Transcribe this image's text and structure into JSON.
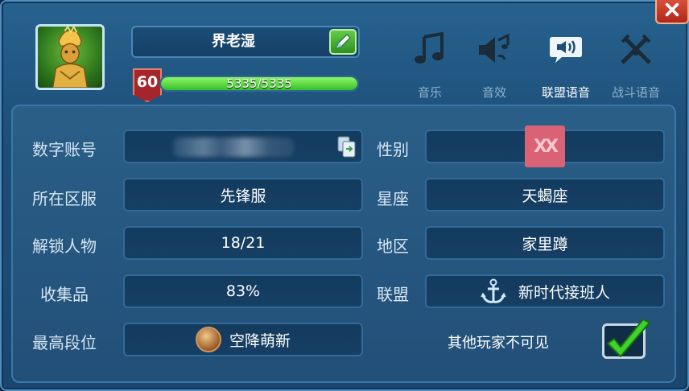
{
  "profile": {
    "name": "界老湿",
    "level": "60",
    "exp_text": "5335/5335",
    "exp_fraction": 1.0
  },
  "sound_tabs": [
    {
      "label": "音乐",
      "icon": "music-note-icon",
      "active": false
    },
    {
      "label": "音效",
      "icon": "sound-effect-icon",
      "active": false
    },
    {
      "label": "联盟语音",
      "icon": "speech-bubble-icon",
      "active": true
    },
    {
      "label": "战斗语音",
      "icon": "crossed-swords-icon",
      "active": false
    }
  ],
  "info": {
    "account_label": "数字账号",
    "gender_label": "性别",
    "gender_icon": "XX",
    "server_label": "所在区服",
    "server_value": "先锋服",
    "zodiac_label": "星座",
    "zodiac_value": "天蝎座",
    "unlock_label": "解锁人物",
    "unlock_value": "18/21",
    "region_label": "地区",
    "region_value": "家里蹲",
    "collection_label": "收集品",
    "collection_value": "83%",
    "alliance_label": "联盟",
    "alliance_value": "新时代接班人",
    "rank_label": "最高段位",
    "rank_value": "空降萌新",
    "hidden_label": "其他玩家不可见",
    "hidden_checked": true
  },
  "colors": {
    "panel_bg": "#1d4f78",
    "exp_green": "#36c02c",
    "level_red": "#a5252a",
    "close_red": "#c23a2a",
    "gender_pink": "#d96375"
  }
}
